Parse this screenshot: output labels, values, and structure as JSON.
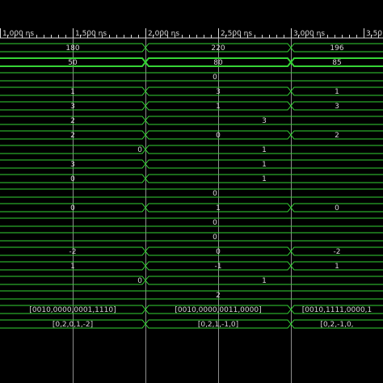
{
  "colors": {
    "background": "#000000",
    "signal": "#35d435",
    "text": "#d8d8d8",
    "cursor_line": "#bfbfbf",
    "ruler": "#d8d8d8"
  },
  "timeline": {
    "labels": [
      "1,000 ns",
      "1,500 ns",
      "2,000 ns",
      "2,500 ns",
      "3,000 ns",
      "3,50"
    ]
  },
  "waveform": {
    "rows": [
      {
        "segments": [
          "180",
          "220",
          "196"
        ]
      },
      {
        "segments": [
          "50",
          "80",
          "85"
        ]
      },
      {
        "segments": [
          "0"
        ]
      },
      {
        "segments": [
          "1",
          "3",
          "1"
        ]
      },
      {
        "segments": [
          "3",
          "1",
          "3"
        ]
      },
      {
        "segments": [
          "2",
          "3"
        ]
      },
      {
        "segments": [
          "2",
          "0",
          "2"
        ]
      },
      {
        "segments": [
          "0",
          "1"
        ]
      },
      {
        "segments": [
          "3",
          "1"
        ]
      },
      {
        "segments": [
          "0",
          "1"
        ]
      },
      {
        "segments": [
          "0"
        ]
      },
      {
        "segments": [
          "0",
          "1",
          "0"
        ]
      },
      {
        "segments": [
          "0"
        ]
      },
      {
        "segments": [
          "0"
        ]
      },
      {
        "segments": [
          "-2",
          "0",
          "-2"
        ]
      },
      {
        "segments": [
          "1",
          "-1",
          "1"
        ]
      },
      {
        "segments": [
          "0",
          "1"
        ]
      },
      {
        "segments": [
          "2"
        ]
      },
      {
        "segments": [
          "[0010,0000,0001,1110]",
          "[0010,0000,0011,0000]",
          "[0010,1111,0000,1"
        ]
      },
      {
        "segments": [
          "[0,2,0,1,-2]",
          "[0,2,1,-1,0]",
          "[0,2,-1,0,"
        ]
      }
    ]
  }
}
